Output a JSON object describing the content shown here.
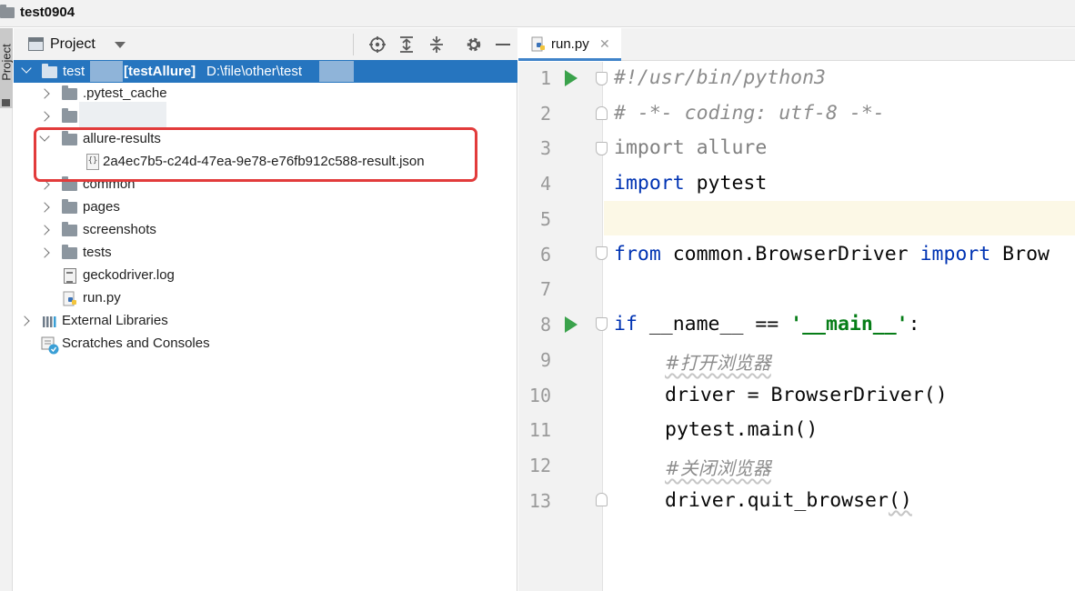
{
  "window": {
    "title": "test0904"
  },
  "tool_stripe": {
    "project_label": "Project"
  },
  "project_panel": {
    "header_title": "Project",
    "toolbar_icons": [
      "locate-icon",
      "expand-all-icon",
      "collapse-all-icon",
      "settings-icon",
      "minimize-icon"
    ],
    "root": {
      "name": "test",
      "module": "[testAllure]",
      "path": "D:\\file\\other\\test"
    },
    "items": [
      {
        "label": ".pytest_cache",
        "kind": "folder",
        "expanded": false
      },
      {
        "label": "",
        "kind": "folder",
        "expanded": false,
        "redacted": true
      },
      {
        "label": "allure-results",
        "kind": "folder",
        "expanded": true
      },
      {
        "label": "2a4ec7b5-c24d-47ea-9e78-e76fb912c588-result.json",
        "kind": "json-file"
      },
      {
        "label": "common",
        "kind": "folder",
        "expanded": false
      },
      {
        "label": "pages",
        "kind": "folder",
        "expanded": false
      },
      {
        "label": "screenshots",
        "kind": "folder",
        "expanded": false
      },
      {
        "label": "tests",
        "kind": "folder",
        "expanded": false
      },
      {
        "label": "geckodriver.log",
        "kind": "log-file"
      },
      {
        "label": "run.py",
        "kind": "python-file"
      }
    ],
    "external_libraries": "External Libraries",
    "scratches": "Scratches and Consoles",
    "highlight_color": "#e23b3b",
    "selection_color": "#2675bf"
  },
  "editor": {
    "tab": {
      "label": "run.py",
      "close": "✕"
    },
    "line_numbers": [
      "1",
      "2",
      "3",
      "4",
      "5",
      "6",
      "7",
      "8",
      "9",
      "10",
      "11",
      "12",
      "13"
    ],
    "lines": {
      "l1": "#!/usr/bin/python3",
      "l2": "# -*- coding: utf-8 -*-",
      "l3_kw": "import",
      "l3_rest": " allure",
      "l4_kw": "import",
      "l4_rest": " pytest",
      "l6_kw": "from",
      "l6_mod": " common.BrowserDriver ",
      "l6_kw2": "import",
      "l6_rest": " Brow",
      "l8_kw": "if",
      "l8_mid": " __name__ == ",
      "l8_str": "'__main__'",
      "l8_end": ":",
      "l9": "#打开浏览器",
      "l10": "driver = BrowserDriver()",
      "l11": "pytest.main()",
      "l12": "#关闭浏览器",
      "l13_pre": "driver.quit_browser",
      "l13_paren": "()"
    },
    "colors": {
      "keyword": "#0033b3",
      "string": "#067d17",
      "comment": "#8c8c8c",
      "run": "#3aa24b"
    }
  }
}
